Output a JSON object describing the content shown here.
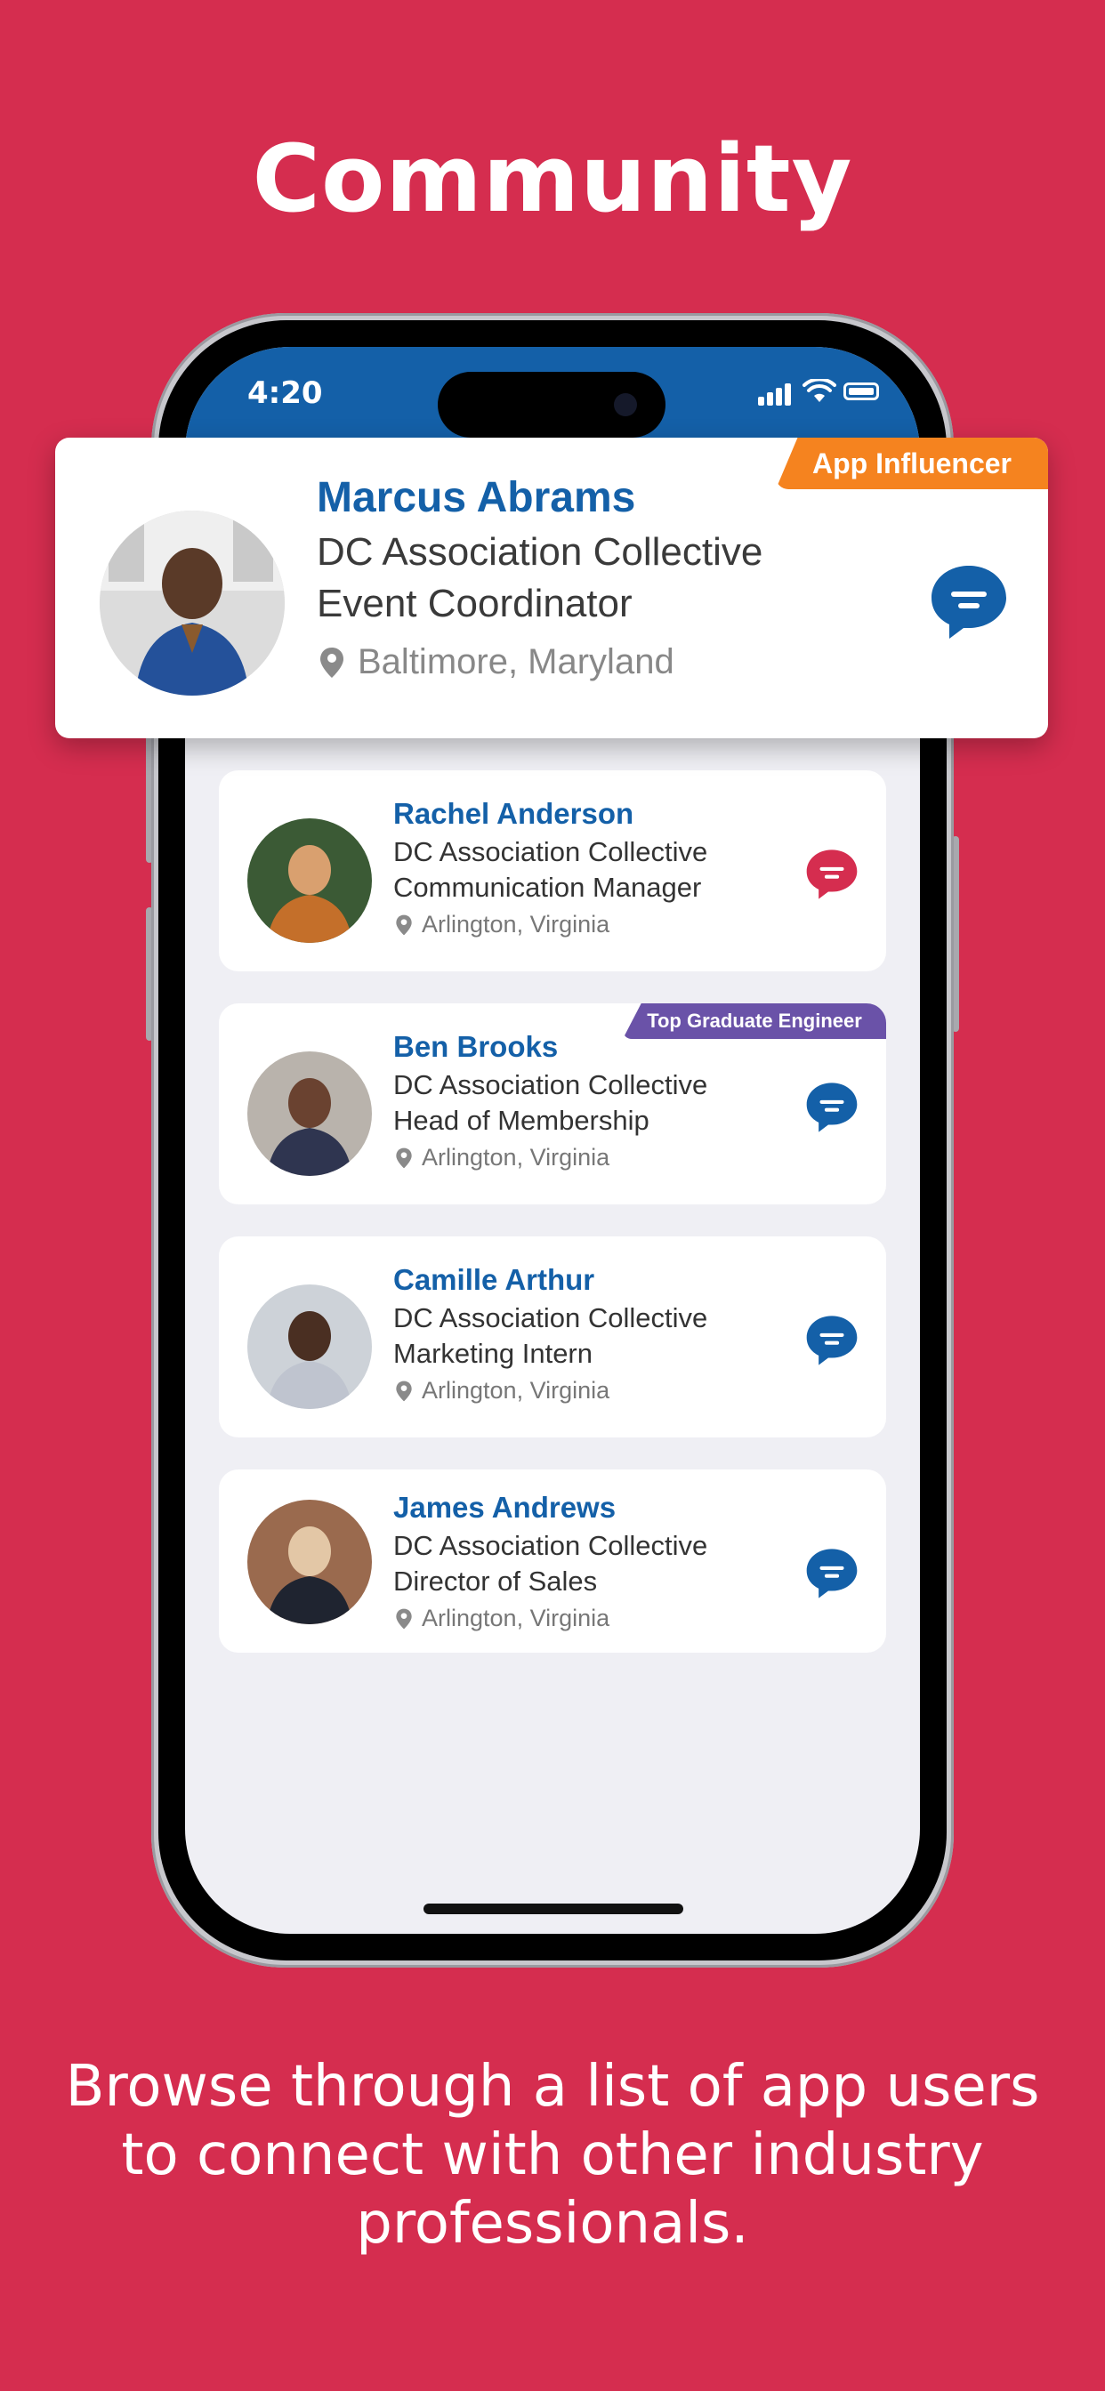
{
  "headline": "Community",
  "caption": "Browse through a list of app users to connect with other industry professionals.",
  "status_bar": {
    "time": "4:20"
  },
  "colors": {
    "background": "#D52D4F",
    "brand_blue": "#1460A8",
    "influencer_orange": "#F5831F",
    "graduate_purple": "#6A52A8",
    "chat_red": "#D52D4F"
  },
  "featured": {
    "badge": "App Influencer",
    "name": "Marcus Abrams",
    "organization": "DC Association Collective",
    "role": "Event Coordinator",
    "location": "Baltimore, Maryland",
    "icons": {
      "location": "location-pin-icon",
      "chat": "chat-bubble-icon"
    }
  },
  "members": [
    {
      "name": "Rachel Anderson",
      "organization": "DC Association Collective",
      "role": "Communication Manager",
      "location": "Arlington, Virginia",
      "badge": "",
      "chat_color": "#D52D4F"
    },
    {
      "name": "Ben Brooks",
      "organization": "DC Association Collective",
      "role": "Head of Membership",
      "location": "Arlington, Virginia",
      "badge": "Top Graduate Engineer",
      "chat_color": "#1460A8"
    },
    {
      "name": "Camille Arthur",
      "organization": "DC Association Collective",
      "role": "Marketing Intern",
      "location": "Arlington, Virginia",
      "badge": "",
      "chat_color": "#1460A8"
    },
    {
      "name": "James Andrews",
      "organization": "DC Association Collective",
      "role": "Director of Sales",
      "location": "Arlington, Virginia",
      "badge": "",
      "chat_color": "#1460A8"
    }
  ]
}
